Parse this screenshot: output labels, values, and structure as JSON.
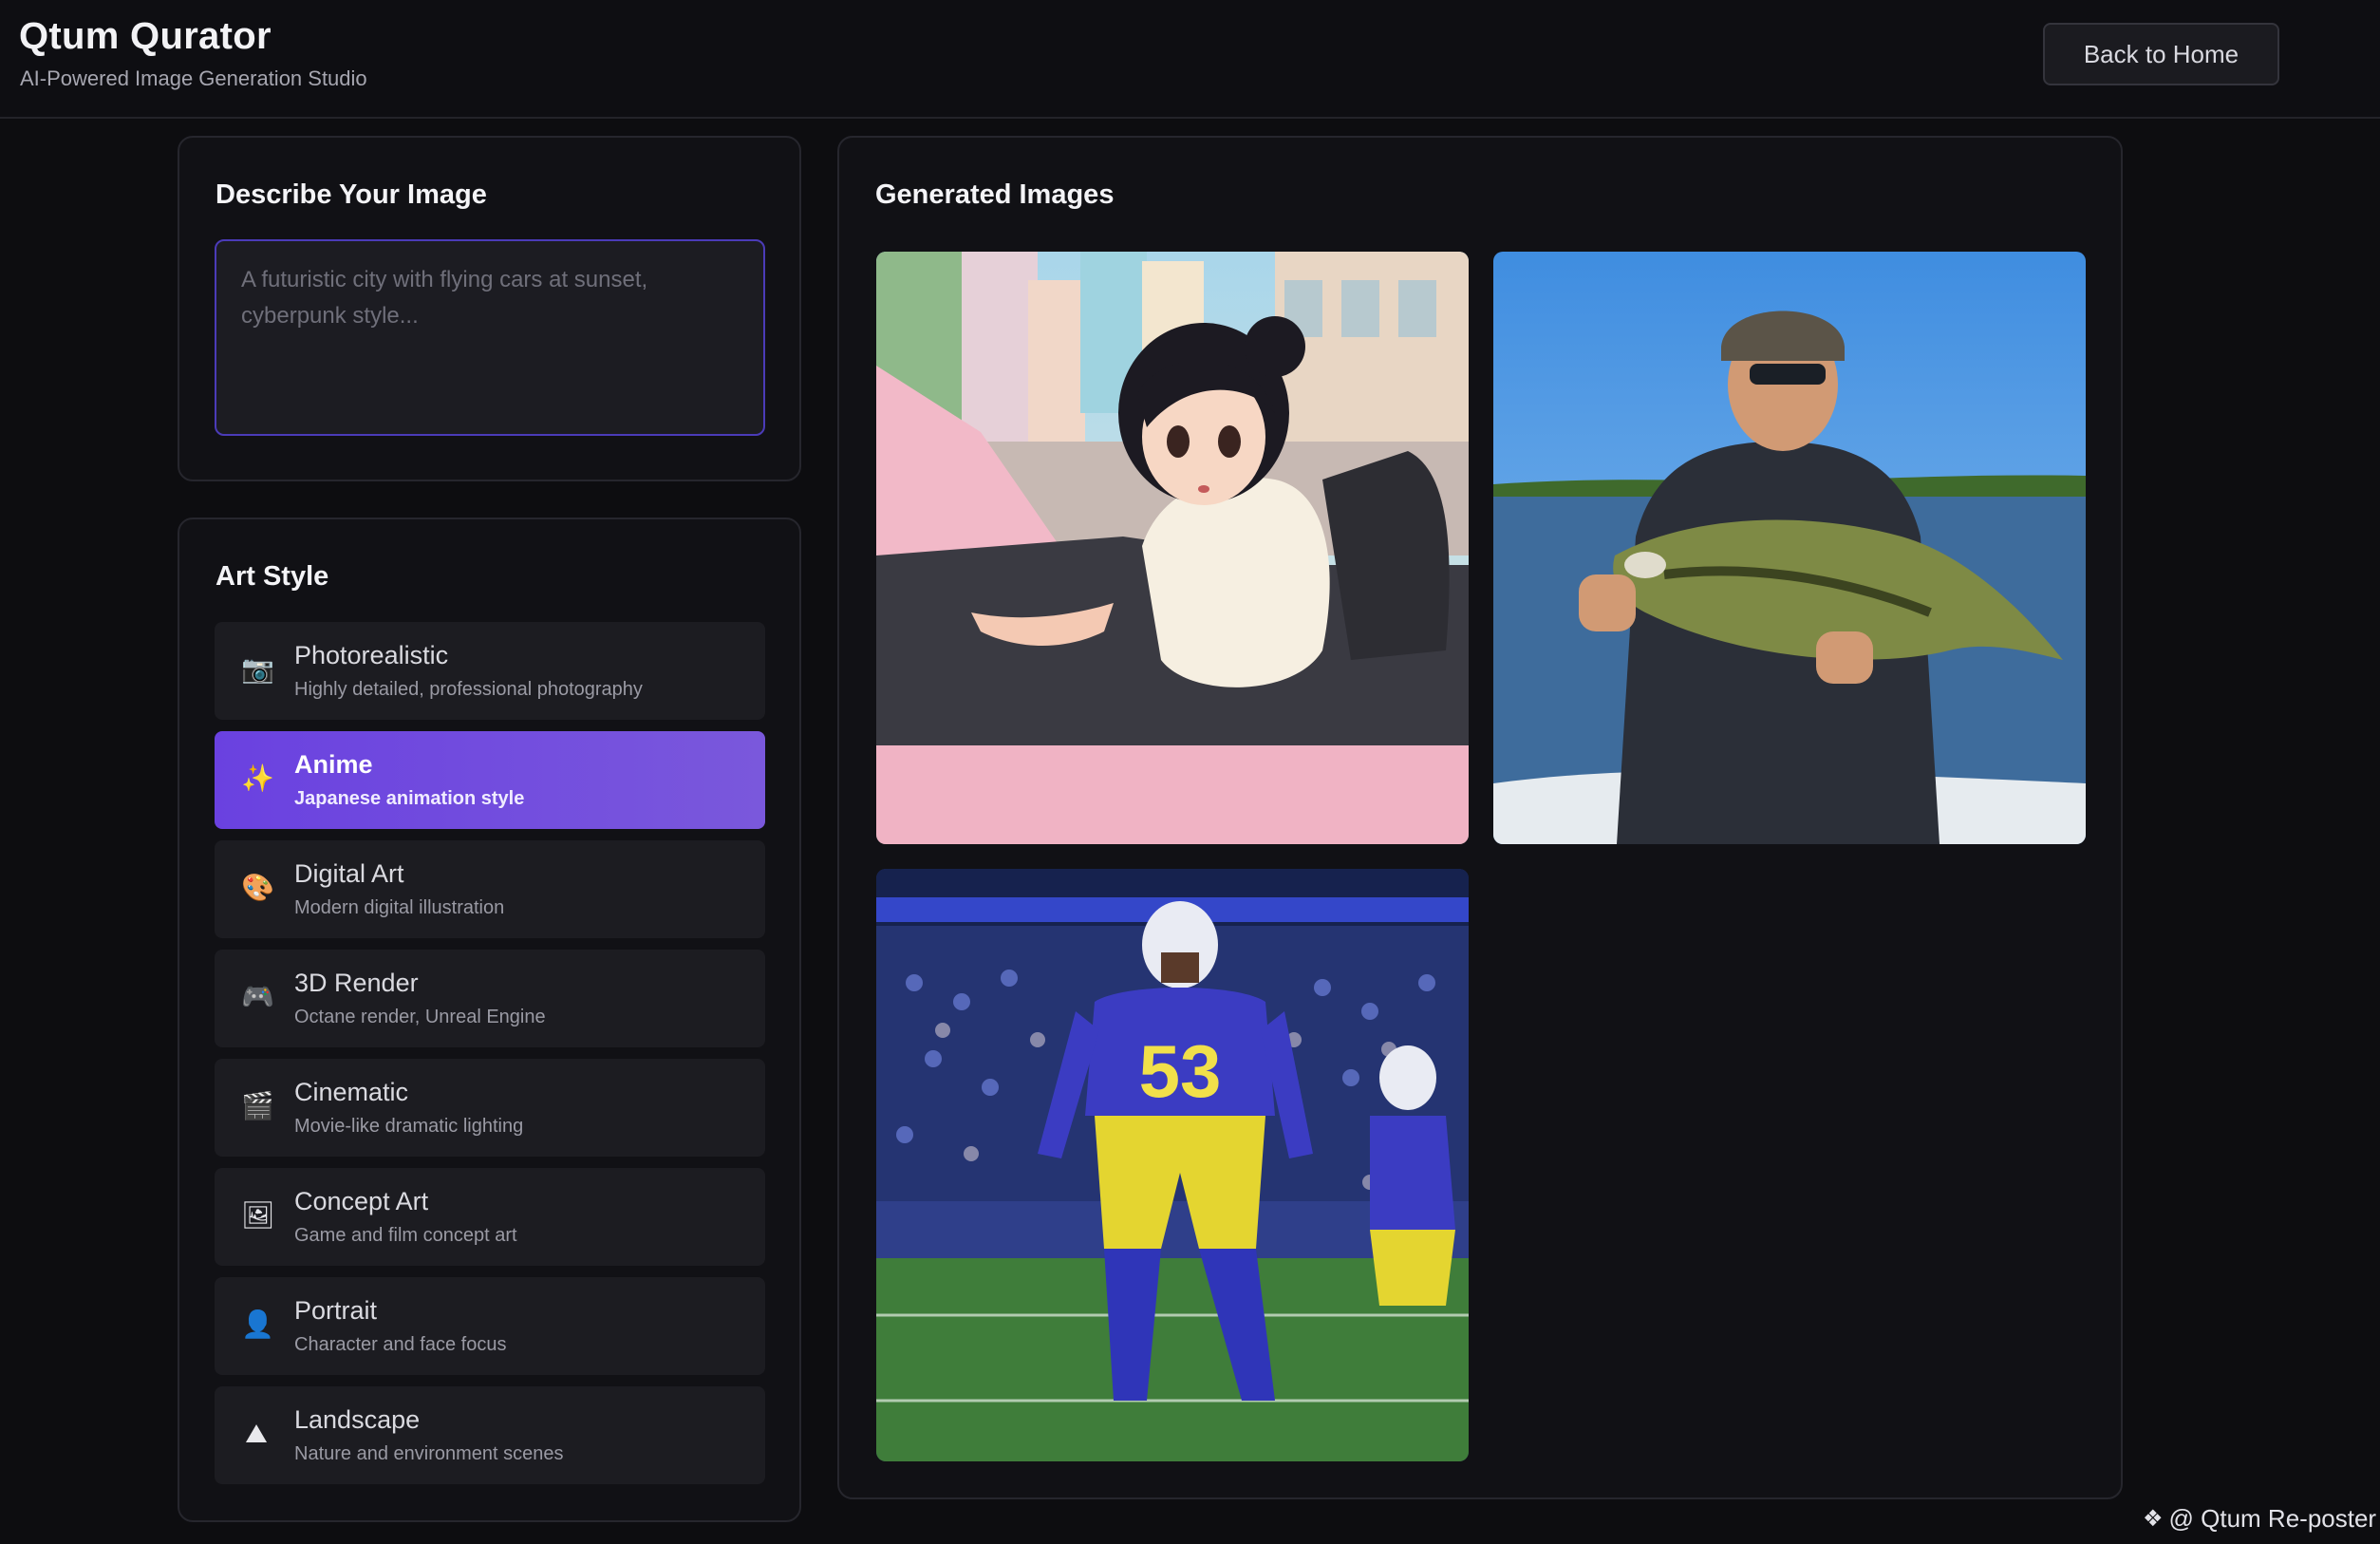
{
  "header": {
    "title": "Qtum Qurator",
    "subtitle": "AI-Powered Image Generation Studio",
    "back_button": "Back to Home"
  },
  "describe": {
    "title": "Describe Your Image",
    "placeholder": "A futuristic city with flying cars at sunset, cyberpunk style..."
  },
  "art_style": {
    "title": "Art Style",
    "selected": "Anime",
    "items": [
      {
        "name": "Photorealistic",
        "desc": "Highly detailed, professional photography",
        "icon": "camera-icon",
        "glyph": "📷"
      },
      {
        "name": "Anime",
        "desc": "Japanese animation style",
        "icon": "sparkles-icon",
        "glyph": "✨"
      },
      {
        "name": "Digital Art",
        "desc": "Modern digital illustration",
        "icon": "palette-icon",
        "glyph": "🎨"
      },
      {
        "name": "3D Render",
        "desc": "Octane render, Unreal Engine",
        "icon": "gamepad-icon",
        "glyph": "🎮"
      },
      {
        "name": "Cinematic",
        "desc": "Movie-like dramatic lighting",
        "icon": "clapperboard-icon",
        "glyph": "🎬"
      },
      {
        "name": "Concept Art",
        "desc": "Game and film concept art",
        "icon": "framed-picture-icon",
        "glyph": "🖼"
      },
      {
        "name": "Portrait",
        "desc": "Character and face focus",
        "icon": "person-icon",
        "glyph": "👤"
      },
      {
        "name": "Landscape",
        "desc": "Nature and environment scenes",
        "icon": "mountain-icon",
        "glyph": "⛰"
      }
    ]
  },
  "gallery": {
    "title": "Generated Images",
    "images": [
      {
        "subject": "anime-girl-driving-pink-convertible"
      },
      {
        "subject": "man-holding-bass-fish-on-lake"
      },
      {
        "subject": "football-player-number-53-on-field"
      }
    ],
    "jersey_number": "53"
  },
  "watermark": {
    "text": "@ Qtum Re-poster"
  },
  "colors": {
    "accent": "#6a41e0",
    "background": "#0d0d10",
    "card": "#111115"
  }
}
